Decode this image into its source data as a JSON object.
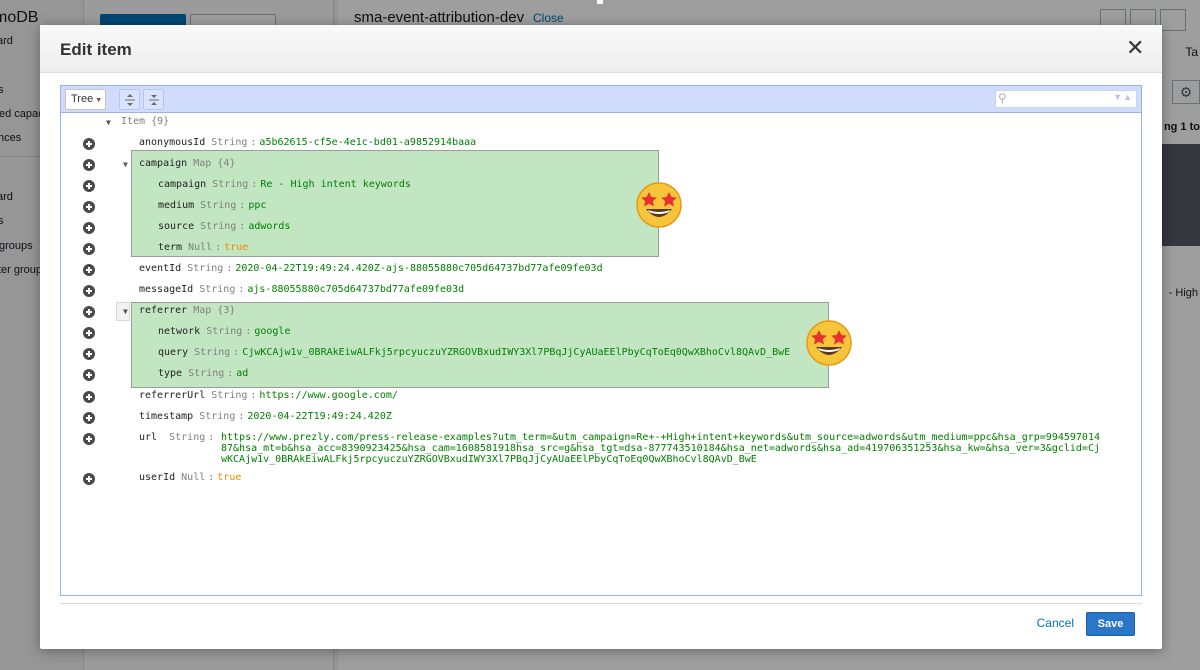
{
  "background": {
    "brand_fragment": "moDB",
    "nav_fragments": [
      "ard",
      "s",
      "ed capac",
      "nces",
      "ard",
      "s",
      "groups",
      "ter group"
    ],
    "table_name": "sma-event-attribution-dev",
    "close_link": "Close",
    "tab_fragment": "Ta",
    "paging_fragment": "ng 1 to",
    "cell_fragment": "- High"
  },
  "modal": {
    "title": "Edit item",
    "close_icon": "close-icon",
    "toolbar": {
      "mode_label": "Tree",
      "expand_icon": "expand-all-icon",
      "collapse_icon": "collapse-all-icon",
      "search_icon": "search-icon",
      "search_value": ""
    },
    "tree": {
      "root_label": "Item",
      "root_count": "{9}",
      "rows": [
        {
          "key": "anonymousId",
          "type": "String",
          "value": "a5b62615-cf5e-4e1c-bd01-a9852914baaa",
          "vtype": "str"
        },
        {
          "key": "campaign",
          "type": "Map",
          "value": "{4}",
          "vtype": "count"
        },
        {
          "key": "campaign",
          "type": "String",
          "value": "Re - High intent keywords",
          "vtype": "str"
        },
        {
          "key": "medium",
          "type": "String",
          "value": "ppc",
          "vtype": "str"
        },
        {
          "key": "source",
          "type": "String",
          "value": "adwords",
          "vtype": "str"
        },
        {
          "key": "term",
          "type": "Null",
          "value": "true",
          "vtype": "null"
        },
        {
          "key": "eventId",
          "type": "String",
          "value": "2020-04-22T19:49:24.420Z-ajs-88055880c705d64737bd77afe09fe03d",
          "vtype": "str"
        },
        {
          "key": "messageId",
          "type": "String",
          "value": "ajs-88055880c705d64737bd77afe09fe03d",
          "vtype": "str"
        },
        {
          "key": "referrer",
          "type": "Map",
          "value": "{3}",
          "vtype": "count"
        },
        {
          "key": "network",
          "type": "String",
          "value": "google",
          "vtype": "str"
        },
        {
          "key": "query",
          "type": "String",
          "value": "CjwKCAjw1v_0BRAkEiwALFkj5rpcyuczuYZRGOVBxudIWY3Xl7PBqJjCyAUaEElPbyCqToEq0QwXBhoCvl8QAvD_BwE",
          "vtype": "str"
        },
        {
          "key": "type",
          "type": "String",
          "value": "ad",
          "vtype": "str"
        },
        {
          "key": "referrerUrl",
          "type": "String",
          "value": "https://www.google.com/",
          "vtype": "str"
        },
        {
          "key": "timestamp",
          "type": "String",
          "value": "2020-04-22T19:49:24.420Z",
          "vtype": "str"
        },
        {
          "key": "url",
          "type": "String",
          "value": "",
          "vtype": "str"
        },
        {
          "key": "userId",
          "type": "Null",
          "value": "true",
          "vtype": "null"
        }
      ],
      "url_lines": [
        "https://www.prezly.com/press-release-examples?utm_term=&utm_campaign=Re+-+High+intent+keywords&utm_source=adwords&utm_medium=ppc&hsa_grp=994597014",
        "87&hsa_mt=b&hsa_acc=8390923425&hsa_cam=1608581918hsa_src=g&hsa_tgt=dsa-877743510184&hsa_net=adwords&hsa_ad=419706351253&hsa_kw=&hsa_ver=3&gclid=Cj",
        "wKCAjw1v_0BRAkEiwALFkj5rpcyuczuYZRGOVBxudIWY3Xl7PBqJjCyAUaEElPbyCqToEq0QwXBhoCvl8QAvD_BwE"
      ]
    },
    "emoji_name": "star-struck-emoji",
    "cancel_label": "Cancel",
    "save_label": "Save"
  }
}
